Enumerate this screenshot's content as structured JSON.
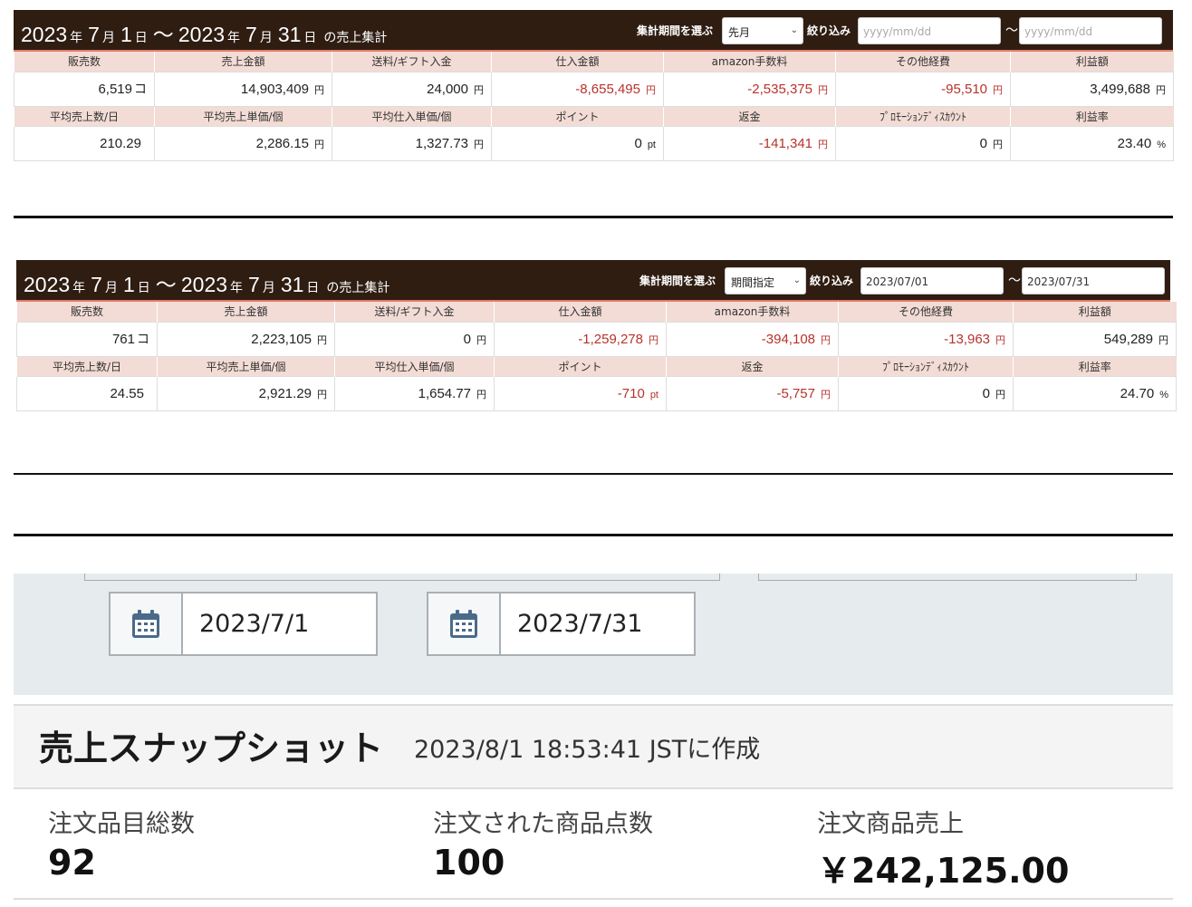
{
  "panels": [
    {
      "title": {
        "y1": "2023",
        "nen": "年",
        "m1": "7",
        "tsuki": "月",
        "d1": "1",
        "hi": "日",
        "sep": "～",
        "y2": "2023",
        "m2": "7",
        "d2": "31",
        "tail": "の売上集計"
      },
      "period_label": "集計期間を選ぶ",
      "period_value": "先月",
      "filter_label": "絞り込み",
      "date_from": "yyyy/mm/dd",
      "date_to": "yyyy/mm/dd",
      "tilde": "～",
      "row1_headers": [
        "販売数",
        "売上金額",
        "送料/ギフト入金",
        "仕入金額",
        "amazon手数料",
        "その他経費",
        "利益額"
      ],
      "row1_values": [
        {
          "v": "6,519",
          "u": "コ"
        },
        {
          "v": "14,903,409",
          "u": "円"
        },
        {
          "v": "24,000",
          "u": "円"
        },
        {
          "v": "-8,655,495",
          "u": "円"
        },
        {
          "v": "-2,535,375",
          "u": "円"
        },
        {
          "v": "-95,510",
          "u": "円"
        },
        {
          "v": "3,499,688",
          "u": "円"
        }
      ],
      "row2_headers": [
        "平均売上数/日",
        "平均売上単価/個",
        "平均仕入単価/個",
        "ポイント",
        "返金",
        "ﾌﾟﾛﾓｰｼｮﾝﾃﾞｨｽｶｳﾝﾄ",
        "利益率"
      ],
      "row2_values": [
        {
          "v": "210.29",
          "u": ""
        },
        {
          "v": "2,286.15",
          "u": "円"
        },
        {
          "v": "1,327.73",
          "u": "円"
        },
        {
          "v": "0",
          "u": "pt"
        },
        {
          "v": "-141,341",
          "u": "円"
        },
        {
          "v": "0",
          "u": "円"
        },
        {
          "v": "23.40",
          "u": "%"
        }
      ]
    },
    {
      "title": {
        "y1": "2023",
        "nen": "年",
        "m1": "7",
        "tsuki": "月",
        "d1": "1",
        "hi": "日",
        "sep": "～",
        "y2": "2023",
        "m2": "7",
        "d2": "31",
        "tail": "の売上集計"
      },
      "period_label": "集計期間を選ぶ",
      "period_value": "期間指定",
      "filter_label": "絞り込み",
      "date_from": "2023/07/01",
      "date_to": "2023/07/31",
      "tilde": "～",
      "row1_headers": [
        "販売数",
        "売上金額",
        "送料/ギフト入金",
        "仕入金額",
        "amazon手数料",
        "その他経費",
        "利益額"
      ],
      "row1_values": [
        {
          "v": "761",
          "u": "コ"
        },
        {
          "v": "2,223,105",
          "u": "円"
        },
        {
          "v": "0",
          "u": "円"
        },
        {
          "v": "-1,259,278",
          "u": "円"
        },
        {
          "v": "-394,108",
          "u": "円"
        },
        {
          "v": "-13,963",
          "u": "円"
        },
        {
          "v": "549,289",
          "u": "円"
        }
      ],
      "row2_headers": [
        "平均売上数/日",
        "平均売上単価/個",
        "平均仕入単価/個",
        "ポイント",
        "返金",
        "ﾌﾟﾛﾓｰｼｮﾝﾃﾞｨｽｶｳﾝﾄ",
        "利益率"
      ],
      "row2_values": [
        {
          "v": "24.55",
          "u": ""
        },
        {
          "v": "2,921.29",
          "u": "円"
        },
        {
          "v": "1,654.77",
          "u": "円"
        },
        {
          "v": "-710",
          "u": "pt"
        },
        {
          "v": "-5,757",
          "u": "円"
        },
        {
          "v": "0",
          "u": "円"
        },
        {
          "v": "24.70",
          "u": "%"
        }
      ]
    }
  ],
  "amazon": {
    "date_start": "2023/7/1",
    "date_end": "2023/7/31",
    "snapshot_title": "売上スナップショット",
    "snapshot_meta": "2023/8/1 18:53:41 JSTに作成",
    "metrics": [
      {
        "label": "注文品目総数",
        "value": "92"
      },
      {
        "label": "注文された商品点数",
        "value": "100"
      },
      {
        "label": "注文商品売上",
        "value": "￥242,125.00"
      }
    ]
  },
  "colors": {
    "header_bg": "#2f1d12",
    "accent_line": "#e07a68",
    "th_bg": "#f3dcd6",
    "negative": "#b8322a",
    "calendar_icon": "#4a6a8a"
  }
}
